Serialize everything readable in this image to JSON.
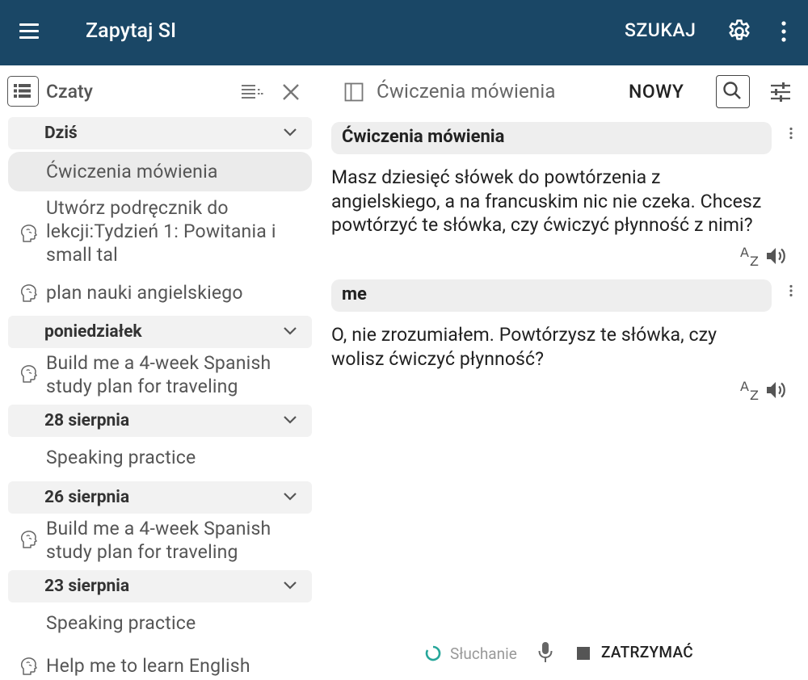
{
  "appbar": {
    "title": "Zapytaj SI",
    "search_label": "SZUKAJ"
  },
  "sidebar": {
    "title": "Czaty",
    "groups": [
      {
        "label": "Dziś"
      },
      {
        "label": "poniedziałek"
      },
      {
        "label": "28 sierpnia"
      },
      {
        "label": "26 sierpnia"
      },
      {
        "label": "23 sierpnia"
      }
    ],
    "items": [
      {
        "label": "Ćwiczenia mówienia"
      },
      {
        "line1": "Utwórz podręcznik do",
        "line2": "lekcji:Tydzień 1: Powitania i",
        "line3": "small tal"
      },
      {
        "label": "plan nauki angielskiego"
      },
      {
        "line1": "Build me a 4-week Spanish",
        "line2": "study plan for traveling"
      },
      {
        "label": "Speaking practice"
      },
      {
        "line1": "Build me a 4-week Spanish",
        "line2": "study plan for traveling"
      },
      {
        "label": "Speaking practice"
      },
      {
        "label": "Help me to learn English"
      }
    ]
  },
  "conversation": {
    "title": "Ćwiczenia mówienia",
    "new_label": "NOWY",
    "messages": [
      {
        "sender": "Ćwiczenia mówienia",
        "lines": [
          "Masz dziesięć słówek do powtórzenia z",
          "angielskiego, a na francuskim nic nie czeka. Chcesz",
          "powtórzyć te słówka, czy ćwiczyć płynność z nimi?"
        ]
      },
      {
        "sender": "me",
        "lines": [
          "O, nie zrozumiałem. Powtórzysz te słówka, czy",
          "wolisz ćwiczyć płynność?"
        ]
      }
    ],
    "translate_glyph_big": "A",
    "translate_glyph_small": "Z"
  },
  "footer": {
    "listening_label": "Słuchanie",
    "stop_label": "ZATRZYMAĆ"
  },
  "colors": {
    "appbar": "#1a4766",
    "accent_spinner": "#26a69a",
    "group_bg": "#f2f2f2",
    "bubble_bg": "#eeeeee"
  }
}
